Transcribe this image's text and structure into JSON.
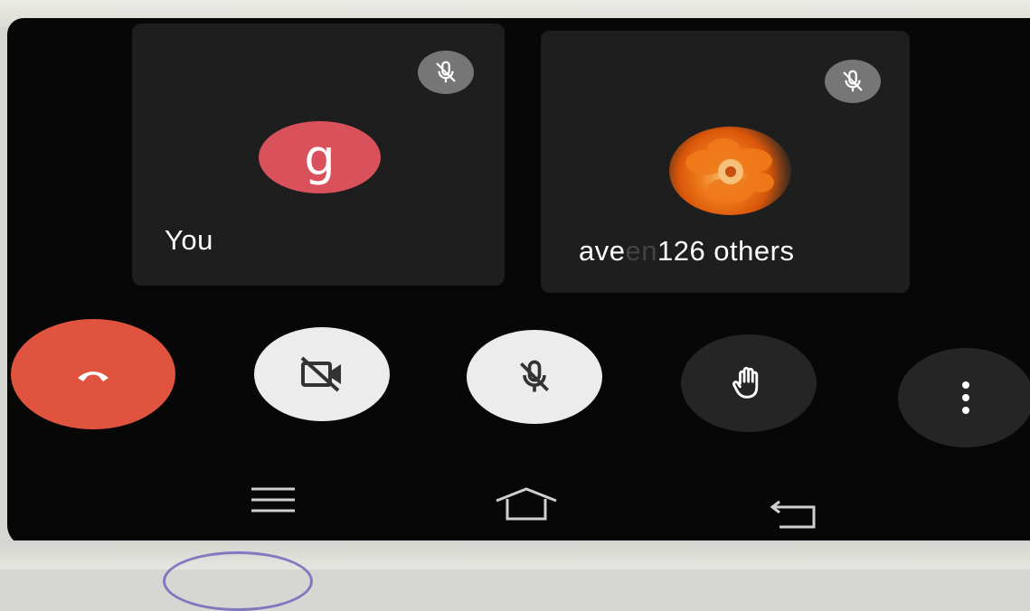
{
  "participants": {
    "self": {
      "label": "You",
      "avatar_letter": "g",
      "muted": true,
      "avatar_color": "#d9515a"
    },
    "others": {
      "label_prefix": "ave",
      "label_faded": "en",
      "label_main": "126 others",
      "muted": true
    }
  },
  "controls": {
    "end_call": {
      "icon": "phone-hangup-icon",
      "color": "#e0533f"
    },
    "camera": {
      "icon": "camera-off-icon",
      "state": "off"
    },
    "microphone": {
      "icon": "mic-off-icon",
      "state": "off"
    },
    "raise_hand": {
      "icon": "hand-icon"
    },
    "more": {
      "icon": "more-vert-icon"
    }
  },
  "navigation": {
    "menu": {
      "icon": "menu-icon"
    },
    "home": {
      "icon": "home-icon"
    },
    "back": {
      "icon": "back-icon"
    }
  }
}
